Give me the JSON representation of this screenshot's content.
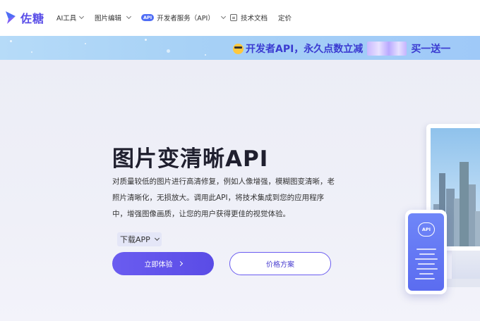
{
  "brand": {
    "name": "佐糖",
    "color": "#5b4fe8"
  },
  "nav": {
    "items": [
      {
        "label": "AI工具",
        "dropdown": true
      },
      {
        "label": "图片编辑",
        "dropdown": true
      },
      {
        "badge": "API",
        "label": "开发者服务（API）",
        "dropdown": true
      },
      {
        "icon": "doc-icon",
        "label": "技术文档",
        "dropdown": false
      },
      {
        "label": "定价",
        "dropdown": false
      }
    ]
  },
  "banner": {
    "text_main": "开发者API，永久点数立减",
    "text_tail": "买一送一"
  },
  "hero": {
    "title": "图片变清晰API",
    "description": "对质量较低的图片进行高清修复，例如人像增强，模糊图变清晰，老照片清晰化，无损放大。调用此API，将技术集成到您的应用程序中，增强图像画质，让您的用户获得更佳的视觉体验。",
    "download_label": "下载APP",
    "primary_button": "立即体验",
    "secondary_button": "价格方案"
  },
  "illustration": {
    "phone_label": "API"
  },
  "colors": {
    "accent": "#6a5cf0",
    "banner_bg": "#a7d1f6",
    "banner_text": "#3b3bd1"
  }
}
